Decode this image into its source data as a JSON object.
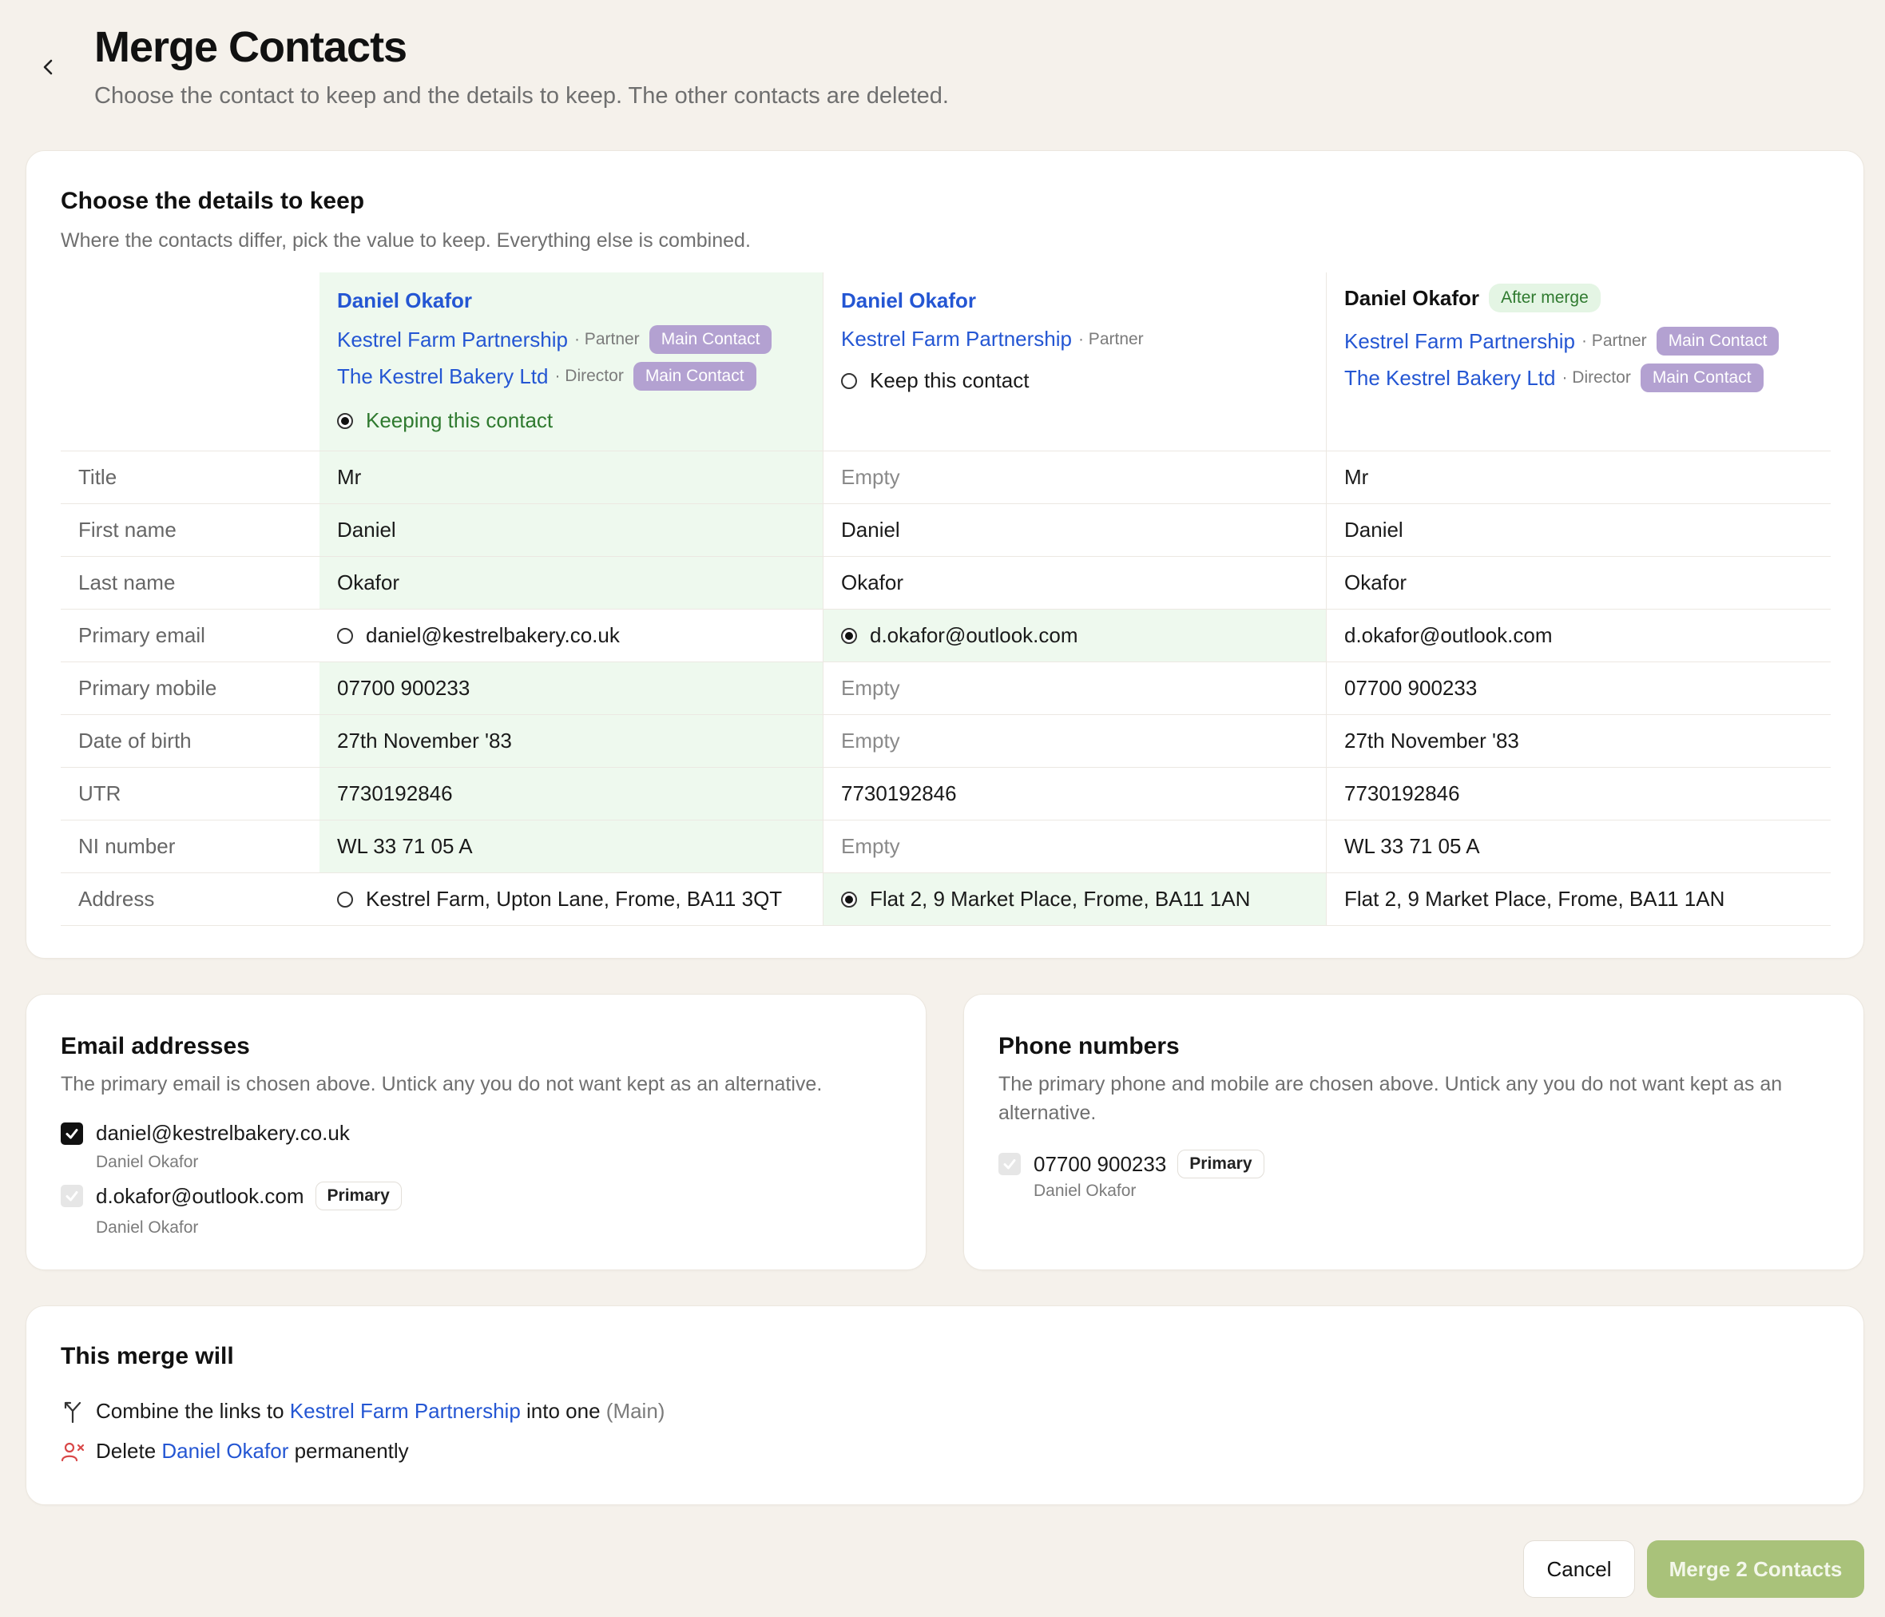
{
  "header": {
    "title": "Merge Contacts",
    "subtitle": "Choose the contact to keep and the details to keep. The other contacts are deleted."
  },
  "details": {
    "title": "Choose the details to keep",
    "subtitle": "Where the contacts differ, pick the value to keep. Everything else is combined.",
    "contacts": [
      {
        "name": "Daniel Okafor",
        "links": [
          {
            "org": "Kestrel Farm Partnership",
            "role": "· Partner",
            "tag": "Main Contact"
          },
          {
            "org": "The Kestrel Bakery Ltd",
            "role": "· Director",
            "tag": "Main Contact"
          }
        ],
        "keep_label": "Keeping this contact"
      },
      {
        "name": "Daniel Okafor",
        "links": [
          {
            "org": "Kestrel Farm Partnership",
            "role": "· Partner",
            "tag": ""
          }
        ],
        "keep_label": "Keep this contact"
      },
      {
        "name": "Daniel Okafor",
        "badge": "After merge",
        "links": [
          {
            "org": "Kestrel Farm Partnership",
            "role": "· Partner",
            "tag": "Main Contact"
          },
          {
            "org": "The Kestrel Bakery Ltd",
            "role": "· Director",
            "tag": "Main Contact"
          }
        ]
      }
    ],
    "rows": [
      {
        "label": "Title",
        "a": "Mr",
        "b": "Empty",
        "result": "Mr"
      },
      {
        "label": "First name",
        "a": "Daniel",
        "b": "Daniel",
        "result": "Daniel"
      },
      {
        "label": "Last name",
        "a": "Okafor",
        "b": "Okafor",
        "result": "Okafor"
      },
      {
        "label": "Primary email",
        "a": "daniel@kestrelbakery.co.uk",
        "b": "d.okafor@outlook.com",
        "result": "d.okafor@outlook.com"
      },
      {
        "label": "Primary mobile",
        "a": "07700 900233",
        "b": "Empty",
        "result": "07700 900233"
      },
      {
        "label": "Date of birth",
        "a": "27th November '83",
        "b": "Empty",
        "result": "27th November '83"
      },
      {
        "label": "UTR",
        "a": "7730192846",
        "b": "7730192846",
        "result": "7730192846"
      },
      {
        "label": "NI number",
        "a": "WL 33 71 05 A",
        "b": "Empty",
        "result": "WL 33 71 05 A"
      },
      {
        "label": "Address",
        "a": "Kestrel Farm, Upton Lane, Frome, BA11 3QT",
        "b": "Flat 2, 9 Market Place, Frome, BA11 1AN",
        "result": "Flat 2, 9 Market Place, Frome, BA11 1AN"
      }
    ]
  },
  "emails": {
    "title": "Email addresses",
    "subtitle": "The primary email is chosen above. Untick any you do not want kept as an alternative.",
    "items": [
      {
        "address": "daniel@kestrelbakery.co.uk",
        "owner": "Daniel Okafor",
        "tag": ""
      },
      {
        "address": "d.okafor@outlook.com",
        "owner": "Daniel Okafor",
        "tag": "Primary"
      }
    ]
  },
  "phones": {
    "title": "Phone numbers",
    "subtitle_1": "The primary phone and mobile are chosen above. Untick any you do not want kept as an",
    "subtitle_2": "alternative.",
    "items": [
      {
        "number": "07700 900233",
        "owner": "Daniel Okafor",
        "tag": "Primary"
      }
    ]
  },
  "merge": {
    "title": "This merge will",
    "line1_prefix": "Combine the links to",
    "line1_link": "Kestrel Farm Partnership",
    "line1_suffix": "into one",
    "line1_note": "(Main)",
    "line2_prefix": "Delete",
    "line2_link": "Daniel Okafor",
    "line2_suffix": "permanently"
  },
  "footer": {
    "cancel_label": "Cancel",
    "merge_label": "Merge 2 Contacts"
  },
  "colors": {
    "background": "#f5f1eb",
    "link": "#2456d3",
    "selected_cell": "#eef9ee",
    "main_contact_tag": "#b3a1d1",
    "keep_green": "#2f7a2f",
    "merge_button": "#a9c27a",
    "delete_icon": "#d94848"
  }
}
